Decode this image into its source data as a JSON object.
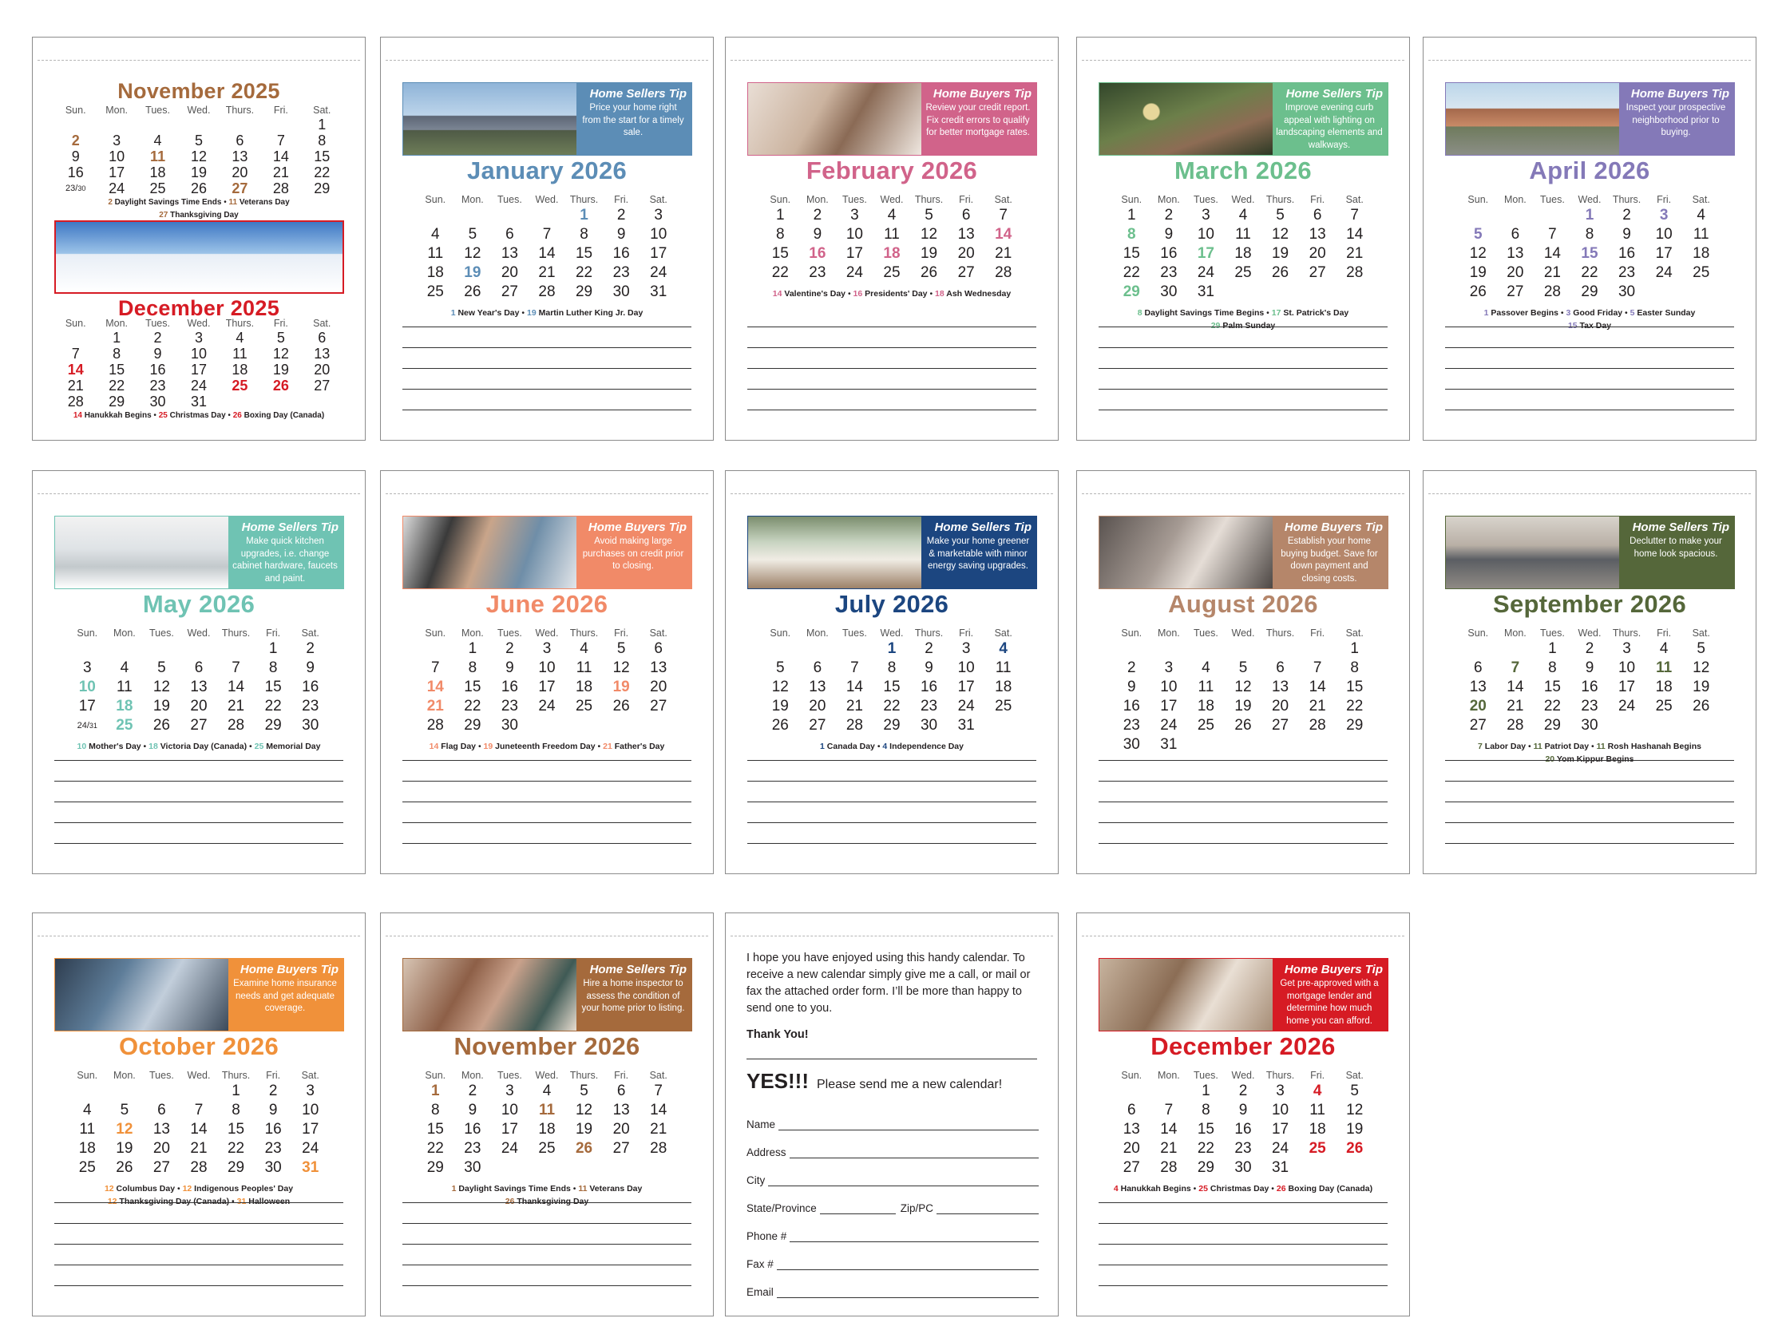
{
  "colors": {
    "nov25": "#a56a3c",
    "dec25": "#d61b24",
    "jan": "#5c8db6",
    "feb": "#d1638a",
    "mar": "#6cbf8d",
    "apr": "#8479b8",
    "may": "#6fc3b3",
    "jun": "#f18a68",
    "jul": "#1c4680",
    "aug": "#b5866a",
    "sep": "#55673a",
    "oct": "#f0913a",
    "nov26": "#a56a3c",
    "dec26": "#d61b24"
  },
  "weekday_labels": [
    "Sun.",
    "Mon.",
    "Tues.",
    "Wed.",
    "Thurs.",
    "Fri.",
    "Sat."
  ],
  "months": [
    {
      "key": "jan",
      "title": "January 2026",
      "tip_head": "Home Sellers Tip",
      "tip_body": "Price your home right from the start for a timely sale.",
      "photo": "house-exterior-photo",
      "weeks": [
        [
          "",
          "",
          "",
          "",
          1,
          2,
          3
        ],
        [
          4,
          5,
          6,
          7,
          8,
          9,
          10
        ],
        [
          11,
          12,
          13,
          14,
          15,
          16,
          17
        ],
        [
          18,
          19,
          20,
          21,
          22,
          23,
          24
        ],
        [
          25,
          26,
          27,
          28,
          29,
          30,
          31
        ]
      ],
      "highlights": [
        1,
        19
      ],
      "holidays": [
        [
          {
            "d": "1",
            "t": "New Year's Day"
          },
          {
            "d": "19",
            "t": "Martin Luther King Jr. Day"
          }
        ]
      ]
    },
    {
      "key": "feb",
      "title": "February 2026",
      "tip_head": "Home Buyers Tip",
      "tip_body": "Review your credit report. Fix credit errors to qualify for better mortgage rates.",
      "photo": "couple-laptop-photo",
      "weeks": [
        [
          1,
          2,
          3,
          4,
          5,
          6,
          7
        ],
        [
          8,
          9,
          10,
          11,
          12,
          13,
          14
        ],
        [
          15,
          16,
          17,
          18,
          19,
          20,
          21
        ],
        [
          22,
          23,
          24,
          25,
          26,
          27,
          28
        ]
      ],
      "highlights": [
        14,
        16,
        18
      ],
      "holidays": [
        [
          {
            "d": "14",
            "t": "Valentine's Day"
          },
          {
            "d": "16",
            "t": "Presidents' Day"
          },
          {
            "d": "18",
            "t": "Ash Wednesday"
          }
        ]
      ]
    },
    {
      "key": "mar",
      "title": "March 2026",
      "tip_head": "Home Sellers Tip",
      "tip_body": "Improve evening curb appeal with lighting on landscaping elements and walkways.",
      "photo": "garden-lights-photo",
      "weeks": [
        [
          1,
          2,
          3,
          4,
          5,
          6,
          7
        ],
        [
          8,
          9,
          10,
          11,
          12,
          13,
          14
        ],
        [
          15,
          16,
          17,
          18,
          19,
          20,
          21
        ],
        [
          22,
          23,
          24,
          25,
          26,
          27,
          28
        ],
        [
          29,
          30,
          31,
          "",
          "",
          "",
          ""
        ]
      ],
      "highlights": [
        8,
        17,
        29
      ],
      "holidays": [
        [
          {
            "d": "8",
            "t": "Daylight Savings Time Begins"
          },
          {
            "d": "17",
            "t": "St. Patrick's Day"
          }
        ],
        [
          {
            "d": "29",
            "t": "Palm Sunday"
          }
        ]
      ]
    },
    {
      "key": "apr",
      "title": "April 2026",
      "tip_head": "Home Buyers Tip",
      "tip_body": "Inspect your prospective neighborhood prior to buying.",
      "photo": "street-houses-photo",
      "weeks": [
        [
          "",
          "",
          "",
          1,
          2,
          3,
          4
        ],
        [
          5,
          6,
          7,
          8,
          9,
          10,
          11
        ],
        [
          12,
          13,
          14,
          15,
          16,
          17,
          18
        ],
        [
          19,
          20,
          21,
          22,
          23,
          24,
          25
        ],
        [
          26,
          27,
          28,
          29,
          30,
          "",
          ""
        ]
      ],
      "highlights": [
        1,
        3,
        5,
        15
      ],
      "holidays": [
        [
          {
            "d": "1",
            "t": "Passover Begins"
          },
          {
            "d": "3",
            "t": "Good Friday"
          },
          {
            "d": "5",
            "t": "Easter Sunday"
          }
        ],
        [
          {
            "d": "15",
            "t": "Tax Day"
          }
        ]
      ]
    },
    {
      "key": "may",
      "title": "May 2026",
      "tip_head": "Home Sellers Tip",
      "tip_body": "Make quick kitchen upgrades, i.e. change cabinet hardware, faucets and paint.",
      "photo": "kitchen-photo",
      "weeks": [
        [
          "",
          "",
          "",
          "",
          "",
          1,
          2
        ],
        [
          3,
          4,
          5,
          6,
          7,
          8,
          9
        ],
        [
          10,
          11,
          12,
          13,
          14,
          15,
          16
        ],
        [
          17,
          18,
          19,
          20,
          21,
          22,
          23
        ],
        [
          "24/31",
          25,
          26,
          27,
          28,
          29,
          30
        ]
      ],
      "highlights": [
        10,
        18,
        25
      ],
      "holidays": [
        [
          {
            "d": "10",
            "t": "Mother's Day"
          },
          {
            "d": "18",
            "t": "Victoria Day (Canada)"
          },
          {
            "d": "25",
            "t": "Memorial Day"
          }
        ]
      ]
    },
    {
      "key": "jun",
      "title": "June 2026",
      "tip_head": "Home Buyers Tip",
      "tip_body": "Avoid making large purchases on credit prior to closing.",
      "photo": "couple-credit-card-photo",
      "weeks": [
        [
          "",
          1,
          2,
          3,
          4,
          5,
          6
        ],
        [
          7,
          8,
          9,
          10,
          11,
          12,
          13
        ],
        [
          14,
          15,
          16,
          17,
          18,
          19,
          20
        ],
        [
          21,
          22,
          23,
          24,
          25,
          26,
          27
        ],
        [
          28,
          29,
          30,
          "",
          "",
          "",
          ""
        ]
      ],
      "highlights": [
        14,
        19,
        21
      ],
      "holidays": [
        [
          {
            "d": "14",
            "t": "Flag Day"
          },
          {
            "d": "19",
            "t": "Juneteenth Freedom Day"
          },
          {
            "d": "21",
            "t": "Father's Day"
          }
        ]
      ]
    },
    {
      "key": "jul",
      "title": "July 2026",
      "tip_head": "Home Sellers Tip",
      "tip_body": "Make your home greener & marketable with minor energy saving upgrades.",
      "photo": "sunroom-photo",
      "weeks": [
        [
          "",
          "",
          "",
          1,
          2,
          3,
          4
        ],
        [
          5,
          6,
          7,
          8,
          9,
          10,
          11
        ],
        [
          12,
          13,
          14,
          15,
          16,
          17,
          18
        ],
        [
          19,
          20,
          21,
          22,
          23,
          24,
          25
        ],
        [
          26,
          27,
          28,
          29,
          30,
          31,
          ""
        ]
      ],
      "highlights": [
        1,
        4
      ],
      "holidays": [
        [
          {
            "d": "1",
            "t": "Canada Day"
          },
          {
            "d": "4",
            "t": "Independence Day"
          }
        ]
      ]
    },
    {
      "key": "aug",
      "title": "August 2026",
      "tip_head": "Home Buyers Tip",
      "tip_body": "Establish your home buying budget. Save for down payment and closing costs.",
      "photo": "women-paperwork-photo",
      "weeks": [
        [
          "",
          "",
          "",
          "",
          "",
          "",
          1
        ],
        [
          2,
          3,
          4,
          5,
          6,
          7,
          8
        ],
        [
          9,
          10,
          11,
          12,
          13,
          14,
          15
        ],
        [
          16,
          17,
          18,
          19,
          20,
          21,
          22
        ],
        [
          23,
          24,
          25,
          26,
          27,
          28,
          29
        ],
        [
          30,
          31,
          "",
          "",
          "",
          "",
          ""
        ]
      ],
      "highlights": [],
      "holidays": []
    },
    {
      "key": "sep",
      "title": "September 2026",
      "tip_head": "Home Sellers Tip",
      "tip_body": "Declutter to make your home look spacious.",
      "photo": "living-room-photo",
      "weeks": [
        [
          "",
          "",
          1,
          2,
          3,
          4,
          5
        ],
        [
          6,
          7,
          8,
          9,
          10,
          11,
          12
        ],
        [
          13,
          14,
          15,
          16,
          17,
          18,
          19
        ],
        [
          20,
          21,
          22,
          23,
          24,
          25,
          26
        ],
        [
          27,
          28,
          29,
          30,
          "",
          "",
          ""
        ]
      ],
      "highlights": [
        7,
        11,
        20
      ],
      "holidays": [
        [
          {
            "d": "7",
            "t": "Labor Day"
          },
          {
            "d": "11",
            "t": "Patriot Day"
          },
          {
            "d": "11",
            "t": "Rosh Hashanah Begins"
          }
        ],
        [
          {
            "d": "20",
            "t": "Yom Kippur Begins"
          }
        ]
      ]
    },
    {
      "key": "oct",
      "title": "October 2026",
      "tip_head": "Home Buyers Tip",
      "tip_body": "Examine home insurance needs and get adequate coverage.",
      "photo": "laptop-user-photo",
      "weeks": [
        [
          "",
          "",
          "",
          "",
          1,
          2,
          3
        ],
        [
          4,
          5,
          6,
          7,
          8,
          9,
          10
        ],
        [
          11,
          12,
          13,
          14,
          15,
          16,
          17
        ],
        [
          18,
          19,
          20,
          21,
          22,
          23,
          24
        ],
        [
          25,
          26,
          27,
          28,
          29,
          30,
          31
        ]
      ],
      "highlights": [
        12,
        31
      ],
      "holidays": [
        [
          {
            "d": "12",
            "t": "Columbus Day"
          },
          {
            "d": "12",
            "t": "Indigenous Peoples' Day"
          }
        ],
        [
          {
            "d": "12",
            "t": "Thanksgiving Day (Canada)"
          },
          {
            "d": "31",
            "t": "Halloween"
          }
        ]
      ]
    },
    {
      "key": "nov26",
      "title": "November 2026",
      "tip_head": "Home Sellers Tip",
      "tip_body": "Hire a home inspector to assess the condition of your home prior to listing.",
      "photo": "inspector-photo",
      "weeks": [
        [
          1,
          2,
          3,
          4,
          5,
          6,
          7
        ],
        [
          8,
          9,
          10,
          11,
          12,
          13,
          14
        ],
        [
          15,
          16,
          17,
          18,
          19,
          20,
          21
        ],
        [
          22,
          23,
          24,
          25,
          26,
          27,
          28
        ],
        [
          29,
          30,
          "",
          "",
          "",
          "",
          ""
        ]
      ],
      "highlights": [
        1,
        11,
        26
      ],
      "holidays": [
        [
          {
            "d": "1",
            "t": "Daylight Savings Time Ends"
          },
          {
            "d": "11",
            "t": "Veterans Day"
          }
        ],
        [
          {
            "d": "26",
            "t": "Thanksgiving Day"
          }
        ]
      ]
    },
    {
      "key": "dec26",
      "title": "December 2026",
      "tip_head": "Home Buyers Tip",
      "tip_body": "Get pre-approved with a mortgage lender and determine how much home you can afford.",
      "photo": "signing-documents-photo",
      "weeks": [
        [
          "",
          "",
          1,
          2,
          3,
          4,
          5
        ],
        [
          6,
          7,
          8,
          9,
          10,
          11,
          12
        ],
        [
          13,
          14,
          15,
          16,
          17,
          18,
          19
        ],
        [
          20,
          21,
          22,
          23,
          24,
          25,
          26
        ],
        [
          27,
          28,
          29,
          30,
          31,
          "",
          ""
        ]
      ],
      "highlights": [
        4,
        25,
        26
      ],
      "holidays": [
        [
          {
            "d": "4",
            "t": "Hanukkah Begins"
          },
          {
            "d": "25",
            "t": "Christmas Day"
          },
          {
            "d": "26",
            "t": "Boxing Day (Canada)"
          }
        ]
      ]
    }
  ],
  "cover": {
    "nov25": {
      "title": "November 2025",
      "weeks": [
        [
          "",
          "",
          "",
          "",
          "",
          "",
          1
        ],
        [
          2,
          3,
          4,
          5,
          6,
          7,
          8
        ],
        [
          9,
          10,
          11,
          12,
          13,
          14,
          15
        ],
        [
          16,
          17,
          18,
          19,
          20,
          21,
          22
        ],
        [
          "23/30",
          24,
          25,
          26,
          27,
          28,
          29
        ]
      ],
      "highlights": [
        2,
        11,
        27
      ],
      "holidays": [
        [
          {
            "d": "2",
            "t": "Daylight Savings Time Ends"
          },
          {
            "d": "11",
            "t": "Veterans Day"
          }
        ],
        [
          {
            "d": "27",
            "t": "Thanksgiving Day"
          }
        ]
      ]
    },
    "dec25": {
      "title": "December 2025",
      "photo": "snowy-house-photo",
      "weeks": [
        [
          "",
          1,
          2,
          3,
          4,
          5,
          6
        ],
        [
          7,
          8,
          9,
          10,
          11,
          12,
          13
        ],
        [
          14,
          15,
          16,
          17,
          18,
          19,
          20
        ],
        [
          21,
          22,
          23,
          24,
          25,
          26,
          27
        ],
        [
          28,
          29,
          30,
          31,
          "",
          "",
          ""
        ]
      ],
      "highlights": [
        14,
        25,
        26
      ],
      "holidays": [
        [
          {
            "d": "14",
            "t": "Hanukkah Begins"
          },
          {
            "d": "25",
            "t": "Christmas Day"
          },
          {
            "d": "26",
            "t": "Boxing Day (Canada)"
          }
        ]
      ]
    }
  },
  "order_form": {
    "message": "I hope you have enjoyed using this handy calendar. To receive a new calendar simply give me a call, or mail or fax the attached order form. I’ll be more than happy to send one to you.",
    "thanks": "Thank You!",
    "yes": "YES!!!",
    "request": "Please send me a new calendar!",
    "fields": {
      "name": "Name",
      "address": "Address",
      "city": "City",
      "state": "State/Province",
      "zip": "Zip/PC",
      "phone": "Phone #",
      "fax": "Fax #",
      "email": "Email"
    }
  }
}
